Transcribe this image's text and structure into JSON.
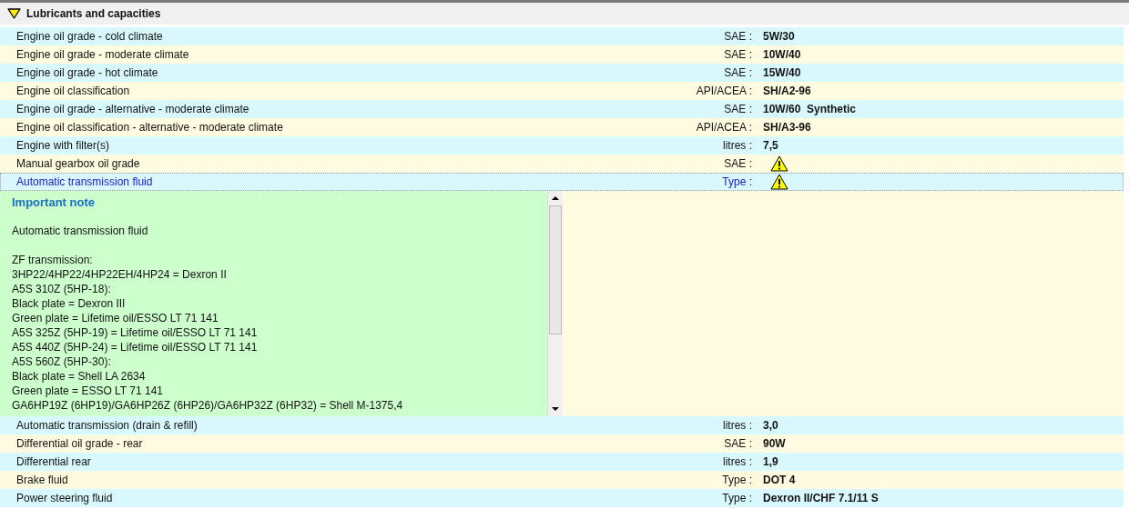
{
  "section": {
    "title": "Lubricants and capacities",
    "expanded": true
  },
  "rows": [
    {
      "kind": "value",
      "label": "Engine oil grade - cold climate",
      "unit": "SAE :",
      "value": "5W/30",
      "selected": false
    },
    {
      "kind": "value",
      "label": "Engine oil grade - moderate climate",
      "unit": "SAE :",
      "value": "10W/40",
      "selected": false
    },
    {
      "kind": "value",
      "label": "Engine oil grade - hot climate",
      "unit": "SAE :",
      "value": "15W/40",
      "selected": false
    },
    {
      "kind": "value",
      "label": "Engine oil classification",
      "unit": "API/ACEA :",
      "value": "SH/A2-96",
      "selected": false
    },
    {
      "kind": "value",
      "label": "Engine oil grade - alternative - moderate climate",
      "unit": "SAE :",
      "value": "10W/60  Synthetic",
      "selected": false
    },
    {
      "kind": "value",
      "label": "Engine oil classification - alternative - moderate climate",
      "unit": "API/ACEA :",
      "value": "SH/A3-96",
      "selected": false
    },
    {
      "kind": "value",
      "label": "Engine with filter(s)",
      "unit": "litres :",
      "value": "7,5",
      "selected": false
    },
    {
      "kind": "warning",
      "label": "Manual gearbox oil grade",
      "unit": "SAE :",
      "selected": false
    },
    {
      "kind": "warning",
      "label": "Automatic transmission fluid",
      "unit": "Type :",
      "selected": true
    }
  ],
  "note": {
    "title": "Important note",
    "paragraphs": [
      [
        "Automatic transmission fluid"
      ],
      [
        "ZF transmission:",
        "3HP22/4HP22/4HP22EH/4HP24 = Dexron II",
        "A5S 310Z (5HP-18):",
        "Black plate = Dexron III",
        "Green plate = Lifetime oil/ESSO LT 71 141",
        "A5S 325Z (5HP-19) = Lifetime oil/ESSO LT 71 141",
        "A5S 440Z (5HP-24) = Lifetime oil/ESSO LT 71 141",
        "A5S 560Z (5HP-30):",
        "Black plate = Shell LA 2634",
        "Green plate = ESSO LT 71 141",
        "GA6HP19Z (6HP19)/GA6HP26Z (6HP26)/GA6HP32Z (6HP32) = Shell M-1375,4"
      ]
    ]
  },
  "rows_after": [
    {
      "kind": "value",
      "label": "Automatic transmission (drain & refill)",
      "unit": "litres :",
      "value": "3,0",
      "selected": false
    },
    {
      "kind": "value",
      "label": "Differential oil grade - rear",
      "unit": "SAE :",
      "value": "90W",
      "selected": false
    },
    {
      "kind": "value",
      "label": "Differential rear",
      "unit": "litres :",
      "value": "1,9",
      "selected": false
    },
    {
      "kind": "value",
      "label": "Brake fluid",
      "unit": "Type :",
      "value": "DOT 4",
      "selected": false
    },
    {
      "kind": "value",
      "label": "Power steering fluid",
      "unit": "Type :",
      "value": "Dexron II/CHF 7.1/11 S",
      "selected": false
    }
  ]
}
